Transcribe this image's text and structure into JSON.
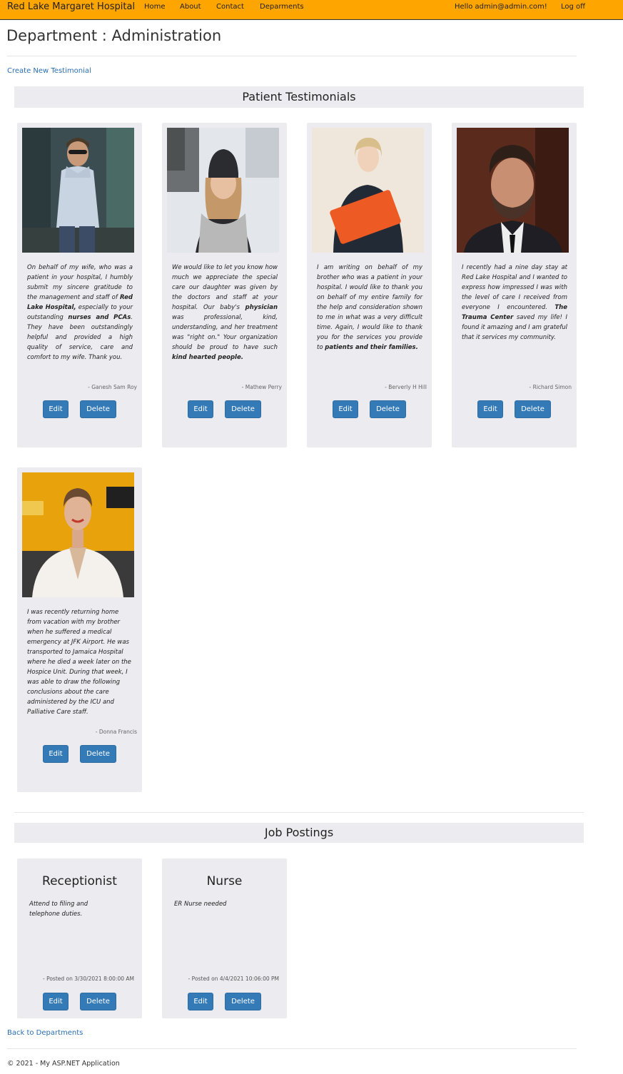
{
  "nav": {
    "brand": "Red Lake Margaret Hospital",
    "links": [
      "Home",
      "About",
      "Contact",
      "Deparments"
    ],
    "greeting": "Hello admin@admin.com!",
    "logoff": "Log off"
  },
  "page": {
    "title": "Department : Administration",
    "create_link": "Create New Testimonial",
    "back_link": "Back to Departments",
    "footer": "© 2021 - My ASP.NET Application"
  },
  "testimonials": {
    "header": "Patient Testimonials",
    "edit_label": "Edit",
    "delete_label": "Delete",
    "items": [
      {
        "parts": [
          {
            "t": "On behalf of my wife, who was a patient in your hospital, I humbly submit my sincere gratitude to the management and staff of "
          },
          {
            "t": "Red Lake Hospital,",
            "b": true
          },
          {
            "t": " especially to your outstanding "
          },
          {
            "t": "nurses and PCAs",
            "b": true
          },
          {
            "t": ". They have been outstandingly helpful and provided a high quality of service, care and comfort to my wife. Thank you."
          }
        ],
        "author": "- Ganesh Sam Roy"
      },
      {
        "parts": [
          {
            "t": "We would like to let you know how much we appreciate the special care our daughter was given by the doctors and staff at your hospital. Our baby's "
          },
          {
            "t": "physician",
            "b": true
          },
          {
            "t": " was professional, kind, understanding, and her treatment was \"right on.\" Your organization should be proud to have such "
          },
          {
            "t": "kind hearted people.",
            "b": true
          }
        ],
        "author": "- Mathew Perry"
      },
      {
        "parts": [
          {
            "t": "I am writing on behalf of my brother who was a patient in your hospital. I would like to thank you on behalf of my entire family for the help and consideration shown to me in what was a very difficult time. Again, I would like to thank you for the services you provide to "
          },
          {
            "t": "patients and their families.",
            "b": true
          }
        ],
        "author": "- Berverly H Hill"
      },
      {
        "parts": [
          {
            "t": "I recently had a nine day stay at Red Lake Hospital and I wanted to express how impressed I was with the level of care I received from everyone I encountered. "
          },
          {
            "t": "The Trauma Center",
            "b": true
          },
          {
            "t": " saved my life! I found it amazing and I am grateful that it services my community."
          }
        ],
        "author": "- Richard Simon"
      },
      {
        "parts": [
          {
            "t": "I was recently returning home from vacation with my brother when he suffered a medical emergency at JFK Airport. He was transported to Jamaica Hospital where he died a week later on the Hospice Unit. During that week, I was able to draw the following conclusions about the care administered by the ICU and Palliative Care staff."
          }
        ],
        "author": "- Donna Francis"
      }
    ]
  },
  "jobs": {
    "header": "Job Postings",
    "items": [
      {
        "title": "Receptionist",
        "description": "Attend to filing and telephone duties.",
        "posted": "- Posted on 3/30/2021 8:00:00 AM"
      },
      {
        "title": "Nurse",
        "description": "ER Nurse needed",
        "posted": "- Posted on 4/4/2021 10:06:00 PM"
      }
    ]
  }
}
